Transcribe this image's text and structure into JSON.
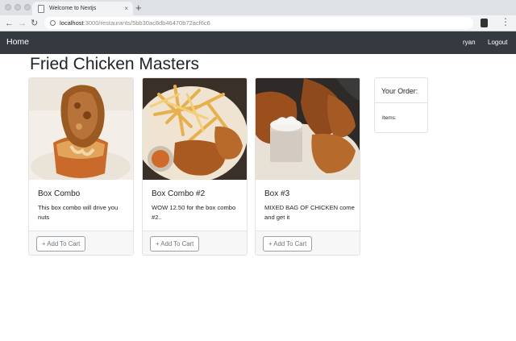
{
  "browser": {
    "tab_title": "Welcome to Nextjs",
    "tab_close": "×",
    "new_tab": "+",
    "back": "←",
    "forward": "→",
    "reload": "↻",
    "url_host": "localhost",
    "url_path": ":3000/restaurants/5bb30ac8db46470b72acf6c6",
    "menu": "⋮"
  },
  "navbar": {
    "home": "Home",
    "user": "ryan",
    "logout": "Logout"
  },
  "page": {
    "title": "Fried Chicken Masters"
  },
  "dishes": [
    {
      "name": "Box Combo",
      "description": "This box combo will drive you nuts",
      "button": "+ Add To Cart"
    },
    {
      "name": "Box Combo #2",
      "description": "WOW 12.50 for the box combo #2..",
      "button": "+ Add To Cart"
    },
    {
      "name": "Box #3",
      "description": "MIXED BAG OF CHICKEN come and get it",
      "button": "+ Add To Cart"
    }
  ],
  "order": {
    "title": "Your Order:",
    "items_label": "Items:"
  }
}
